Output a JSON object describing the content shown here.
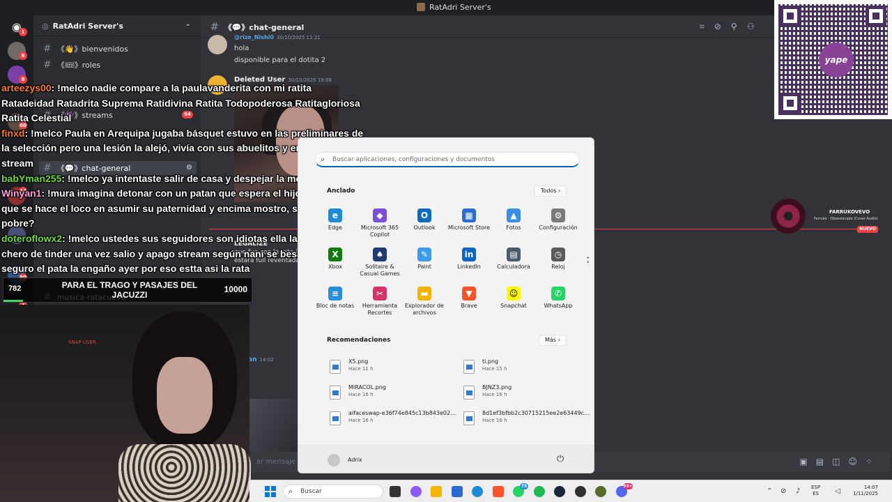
{
  "window_title": "RatAdri Server's",
  "server": {
    "name": "RatAdri Server's"
  },
  "channels": [
    {
      "name": "《👋》bienvenidos"
    },
    {
      "name": "《🎟》roles"
    },
    {
      "name": "《👾》streams",
      "badge": "94"
    },
    {
      "name": "《💬》chat-general"
    },
    {
      "name": "musica-ratacueva"
    }
  ],
  "guild_badges": [
    "1",
    "6",
    "1",
    "8",
    "60",
    "44",
    "8",
    "90",
    "4"
  ],
  "chat_header": {
    "channel": "《💬》chat-general"
  },
  "messages": [
    {
      "author": "@rize_Nishi0",
      "timestamp": "30/10/2025 11:21",
      "lines": [
        "hola",
        "disponible para el dotita 2"
      ]
    },
    {
      "author": "Deleted User",
      "timestamp": "30/10/2025 19:08"
    },
    {
      "author": "LEGALIZE",
      "lines": [
        "que fue con la rata j...",
        "estara full reventada..."
      ]
    },
    {
      "author": "an",
      "timestamp": "14:02"
    }
  ],
  "chat_input": {
    "placeholder": "ar mensaje a #"
  },
  "music": {
    "artist": "FARRUKOVEVO",
    "song": "Farruko - Obsesionado (Cover Audio)",
    "new_label": "NUEVO"
  },
  "qr": {
    "brand": "yape"
  },
  "stream_chat": [
    {
      "user": "arteezys00",
      "text": ": !melco nadie compare a la paulavanderita con mi ratita Ratadeidad Ratadrita Suprema Ratidivina Ratita Todopoderosa Ratitagloriosa Ratita Celestial"
    },
    {
      "user": "finxd",
      "text": ": !melco Paula en Arequipa jugaba básquet estuvo en las preliminares de la selección pero una lesión la alejó, vivía con sus abuelitos y empezó a hacer stream"
    },
    {
      "user": "babYman255",
      "text": ": !melco ya intentaste salir de casa y despejar la mente?"
    },
    {
      "user": "Winyan1",
      "text": ": !mura imagina detonar con un patan que espera el hijo de otra y que se hace el loco en asumir su paternidad y encima mostro, sin estudios y pobre?"
    },
    {
      "user": "doteroflowx2",
      "text": ": !melco ustedes sus seguidores son idiotas ella la rata tiene su chero de tinder una vez salio y apago stream según nani se besaron babosos, seguro el pata la engaño ayer por eso estta asi la rata"
    }
  ],
  "goal": {
    "current": "782",
    "label": "PARA EL TRAGO Y PASAJES DEL JACUZZI",
    "target": "10000",
    "progress": 0.078
  },
  "cam_overlay_text": "SNAP USER",
  "start_menu": {
    "search_placeholder": "Buscar aplicaciones, configuraciones y documentos",
    "pinned_title": "Anclado",
    "all_button": "Todos",
    "pinned": [
      {
        "name": "Edge",
        "icon": "edge-icon",
        "color": "#1f8ad6"
      },
      {
        "name": "Microsoft 365 Copilot",
        "icon": "copilot-icon",
        "color": "#7b4fd6"
      },
      {
        "name": "Outlook",
        "icon": "outlook-icon",
        "color": "#0f6cbd"
      },
      {
        "name": "Microsoft Store",
        "icon": "store-icon",
        "color": "#2b6cd4"
      },
      {
        "name": "Fotos",
        "icon": "photos-icon",
        "color": "#3a8ee6"
      },
      {
        "name": "Configuración",
        "icon": "settings-icon",
        "color": "#7a7a7a"
      },
      {
        "name": "Xbox",
        "icon": "xbox-icon",
        "color": "#107c10"
      },
      {
        "name": "Solitaire & Casual Games",
        "icon": "solitaire-icon",
        "color": "#1e3a6e"
      },
      {
        "name": "Paint",
        "icon": "paint-icon",
        "color": "#3d9be9"
      },
      {
        "name": "LinkedIn",
        "icon": "linkedin-icon",
        "color": "#0a66c2"
      },
      {
        "name": "Calculadora",
        "icon": "calculator-icon",
        "color": "#4a5a6a"
      },
      {
        "name": "Reloj",
        "icon": "clock-icon",
        "color": "#5a5a5a"
      },
      {
        "name": "Bloc de notas",
        "icon": "notepad-icon",
        "color": "#2a8fd8"
      },
      {
        "name": "Herramienta Recortes",
        "icon": "snipping-icon",
        "color": "#d6336c"
      },
      {
        "name": "Explorador de archivos",
        "icon": "folder-icon",
        "color": "#f4b400"
      },
      {
        "name": "Brave",
        "icon": "brave-icon",
        "color": "#fb542b"
      },
      {
        "name": "Snapchat",
        "icon": "snapchat-icon",
        "color": "#fffc00"
      },
      {
        "name": "WhatsApp",
        "icon": "whatsapp-icon",
        "color": "#25d366"
      }
    ],
    "recommended_title": "Recomendaciones",
    "more_button": "Más",
    "recommended": [
      {
        "name": "X5.png",
        "time": "Hace 11 h"
      },
      {
        "name": "ti.png",
        "time": "Hace 15 h"
      },
      {
        "name": "MIRACOL.png",
        "time": "Hace 16 h"
      },
      {
        "name": "BJNZ3.png",
        "time": "Hace 16 h"
      },
      {
        "name": "aifaceswap-e36f74e845c13b843e02...",
        "time": "Hace 16 h"
      },
      {
        "name": "8d1ef3bfbb2c30715215ee2e63449c...",
        "time": "Hace 16 h"
      }
    ],
    "user": "Adrix"
  },
  "taskbar": {
    "search_label": "Buscar",
    "apps": [
      {
        "icon": "taskview-icon",
        "color": "#333333"
      },
      {
        "icon": "copilot-icon",
        "color": "#8a5cf6"
      },
      {
        "icon": "folder-icon",
        "color": "#f4b400"
      },
      {
        "icon": "store-icon",
        "color": "#2b6cd4"
      },
      {
        "icon": "edge-icon",
        "color": "#1f8ad6"
      },
      {
        "icon": "brave-icon",
        "color": "#fb542b"
      },
      {
        "icon": "whatsapp-icon",
        "color": "#25d366"
      },
      {
        "icon": "spotify-icon",
        "color": "#1db954"
      },
      {
        "icon": "steam-icon",
        "color": "#1b2838"
      },
      {
        "icon": "obs-icon",
        "color": "#302e31"
      },
      {
        "icon": "nvidia-icon",
        "color": "#5a6b2a"
      },
      {
        "icon": "discord-icon",
        "color": "#5865f2"
      }
    ],
    "whatsapp_badge": "75",
    "discord_badge": "99+",
    "lang_top": "ESP",
    "lang_bottom": "ES",
    "time": "14:07",
    "date": "1/11/2025"
  }
}
